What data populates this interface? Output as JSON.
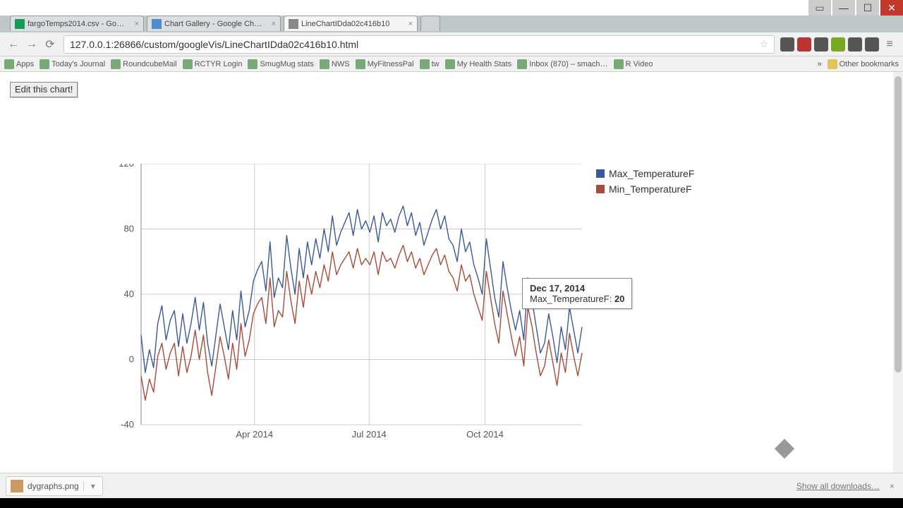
{
  "os": {
    "user": "▭",
    "min": "—",
    "max": "☐",
    "close": "✕"
  },
  "tabs": [
    {
      "title": "fargoTemps2014.csv - Go…",
      "fav": "#0f9d58"
    },
    {
      "title": "Chart Gallery - Google Ch…",
      "fav": "#4e8cce"
    },
    {
      "title": "LineChartIDda02c416b10",
      "fav": "#888",
      "active": true
    }
  ],
  "nav": {
    "back": "←",
    "fwd": "→",
    "reload": "⟳",
    "menu": "≡"
  },
  "url": "127.0.0.1:26866/custom/googleVis/LineChartIDda02c416b10.html",
  "star": "☆",
  "extensions": [
    "#555",
    "#b33",
    "#555",
    "#7a2",
    "#555",
    "#555"
  ],
  "bookmarks": [
    "Apps",
    "Today's Journal",
    "RoundcubeMail",
    "RCTYR Login",
    "SmugMug stats",
    "NWS",
    "MyFitnessPal",
    "tw",
    "My Health Stats",
    "Inbox (870) – smach…",
    "R Video"
  ],
  "bm_right": {
    "chev": "»",
    "other": "Other bookmarks"
  },
  "page": {
    "edit_btn": "Edit this chart!"
  },
  "legend": {
    "s1": "Max_TemperatureF",
    "s2": "Min_TemperatureF"
  },
  "tooltip": {
    "date": "Dec 17, 2014",
    "label": "Max_TemperatureF:",
    "value": "20"
  },
  "downloads": {
    "file": "dygraphs.png",
    "showall": "Show all downloads…",
    "close": "×"
  },
  "chart_data": {
    "type": "line",
    "xlabel": "",
    "ylabel": "",
    "ylim": [
      -40,
      120
    ],
    "y_ticks": [
      -40,
      0,
      40,
      80,
      120
    ],
    "x_tick_labels": [
      "Apr 2014",
      "Jul 2014",
      "Oct 2014"
    ],
    "x_tick_positions_days": [
      90,
      181,
      273
    ],
    "n_days": 351,
    "colors": {
      "Max_TemperatureF": "#3b5998",
      "Min_TemperatureF": "#a84b3a"
    },
    "tooltip_point": {
      "day": 350,
      "series": "Max_TemperatureF",
      "value": 20
    },
    "series": [
      {
        "name": "Max_TemperatureF",
        "values": [
          15,
          -8,
          6,
          -5,
          22,
          33,
          12,
          24,
          30,
          8,
          28,
          10,
          22,
          38,
          18,
          35,
          10,
          -4,
          15,
          34,
          20,
          6,
          30,
          12,
          42,
          20,
          30,
          48,
          55,
          60,
          42,
          72,
          38,
          50,
          44,
          76,
          56,
          40,
          68,
          50,
          72,
          58,
          74,
          62,
          80,
          66,
          88,
          70,
          78,
          84,
          90,
          76,
          92,
          80,
          85,
          78,
          88,
          72,
          90,
          82,
          86,
          78,
          88,
          94,
          82,
          90,
          76,
          84,
          70,
          78,
          86,
          92,
          80,
          88,
          74,
          70,
          60,
          80,
          66,
          72,
          58,
          50,
          40,
          74,
          56,
          38,
          26,
          60,
          44,
          30,
          18,
          30,
          12,
          50,
          36,
          20,
          4,
          10,
          28,
          14,
          -2,
          20,
          6,
          32,
          18,
          4,
          20
        ]
      },
      {
        "name": "Min_TemperatureF",
        "values": [
          -10,
          -25,
          -12,
          -20,
          2,
          10,
          -6,
          4,
          10,
          -10,
          8,
          -8,
          2,
          18,
          0,
          15,
          -8,
          -22,
          -4,
          14,
          2,
          -12,
          10,
          -6,
          22,
          2,
          12,
          28,
          34,
          38,
          22,
          50,
          20,
          30,
          26,
          54,
          36,
          22,
          48,
          32,
          52,
          40,
          54,
          44,
          58,
          48,
          66,
          52,
          58,
          62,
          66,
          56,
          68,
          58,
          62,
          58,
          66,
          52,
          66,
          60,
          62,
          56,
          64,
          70,
          60,
          66,
          56,
          62,
          52,
          58,
          64,
          68,
          58,
          64,
          54,
          50,
          42,
          58,
          48,
          52,
          40,
          32,
          24,
          54,
          38,
          22,
          10,
          42,
          28,
          14,
          2,
          14,
          -4,
          32,
          20,
          4,
          -10,
          -4,
          12,
          -2,
          -16,
          4,
          -8,
          16,
          2,
          -10,
          4
        ]
      }
    ]
  }
}
